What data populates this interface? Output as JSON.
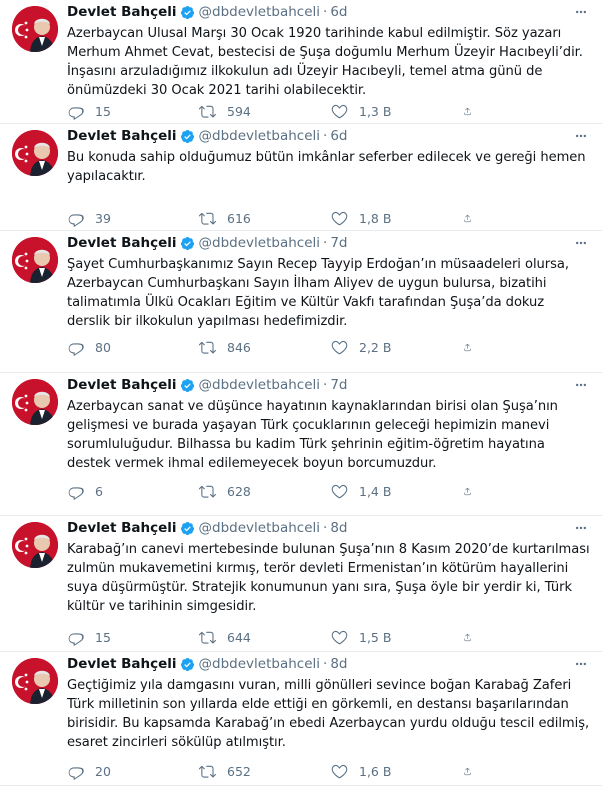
{
  "user": {
    "name": "Devlet Bahçeli",
    "handle": "@dbdevletbahceli",
    "dot": "·"
  },
  "colors": {
    "verified": "#1da1f2",
    "avatar_bg": "#c8122b",
    "muted": "#5b7083"
  },
  "tweets": [
    {
      "time": "6d",
      "text": "Azerbaycan Ulusal Marşı 30 Ocak 1920 tarihinde kabul edilmiştir. Söz yazarı Merhum Ahmet Cevat, bestecisi de Şuşa doğumlu Merhum Üzeyir Hacıbeyli’dir. İnşasını arzuladığımız ilkokulun adı Üzeyir Hacıbeyli, temel atma günü de önümüzdeki 30 Ocak 2021 tarihi olabilecektir.",
      "replies": "15",
      "retweets": "594",
      "likes": "1,3 B"
    },
    {
      "time": "6d",
      "text": "Bu konuda sahip olduğumuz bütün imkânlar seferber edilecek ve gereği hemen yapılacaktır.",
      "replies": "39",
      "retweets": "616",
      "likes": "1,8 B"
    },
    {
      "time": "7d",
      "text": "Şayet Cumhurbaşkanımız Sayın Recep Tayyip Erdoğan’ın müsaadeleri olursa, Azerbaycan Cumhurbaşkanı Sayın İlham Aliyev de uygun bulursa, bizatihi talimatımla Ülkü Ocakları Eğitim ve Kültür Vakfı tarafından Şuşa’da dokuz derslik bir ilkokulun yapılması hedefimizdir.",
      "replies": "80",
      "retweets": "846",
      "likes": "2,2 B"
    },
    {
      "time": "7d",
      "text": "Azerbaycan sanat ve düşünce hayatının kaynaklarından birisi olan Şuşa’nın gelişmesi ve burada yaşayan Türk çocuklarının geleceği hepimizin manevi sorumluluğudur. Bilhassa bu kadim Türk şehrinin eğitim-öğretim hayatına destek vermek ihmal edilemeyecek boyun borcumuzdur.",
      "replies": "6",
      "retweets": "628",
      "likes": "1,4 B"
    },
    {
      "time": "8d",
      "text": "Karabağ’ın canevi mertebesinde bulunan Şuşa’nın 8 Kasım 2020’de kurtarılması zulmün mukavemetini kırmış, terör devleti Ermenistan’ın kötürüm hayallerini suya düşürmüştür. Stratejik konumunun yanı sıra, Şuşa öyle bir yerdir ki, Türk kültür ve tarihinin simgesidir.",
      "replies": "15",
      "retweets": "644",
      "likes": "1,5 B"
    },
    {
      "time": "8d",
      "text": "Geçtiğimiz yıla damgasını vuran, milli gönülleri sevince boğan Karabağ Zaferi Türk milletinin son yıllarda elde ettiği en görkemli, en destansı başarılarından birisidir. Bu kapsamda Karabağ’ın ebedi Azerbaycan yurdu olduğu tescil edilmiş, esaret zincirleri sökülüp atılmıştır.",
      "replies": "20",
      "retweets": "652",
      "likes": "1,6 B"
    }
  ]
}
